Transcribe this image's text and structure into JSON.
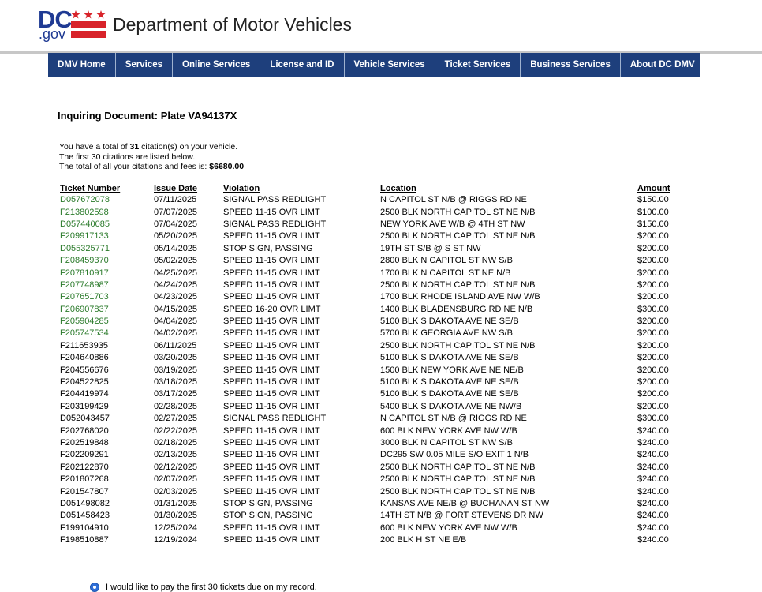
{
  "header": {
    "logo_dc": "DC",
    "logo_gov": ".gov",
    "title": "Department of Motor Vehicles",
    "brand_color": "#1f3a93",
    "flag_color": "#d8232a"
  },
  "nav": {
    "items": [
      {
        "label": "DMV Home"
      },
      {
        "label": "Services"
      },
      {
        "label": "Online Services"
      },
      {
        "label": "License and ID"
      },
      {
        "label": "Vehicle Services"
      },
      {
        "label": "Ticket Services"
      },
      {
        "label": "Business Services"
      },
      {
        "label": "About DC DMV"
      }
    ],
    "color": "#1e3f7c"
  },
  "document": {
    "title": "Inquiring Document: Plate VA94137X",
    "line1_pre": "You have a total of ",
    "line1_count": "31",
    "line1_post": " citation(s) on your vehicle.",
    "line2": "The first 30 citations are listed below.",
    "line3_pre": "The total of all your citations and fees is: ",
    "line3_total": "$6680.00"
  },
  "table": {
    "headers": [
      "Ticket Number",
      "Issue Date",
      "Violation",
      "Location",
      "Amount"
    ],
    "rows": [
      {
        "ticket": "D057672078",
        "date": "07/11/2025",
        "violation": "SIGNAL PASS REDLIGHT",
        "location": "N CAPITOL ST N/B @ RIGGS RD NE",
        "amount": "$150.00",
        "linked": true
      },
      {
        "ticket": "F213802598",
        "date": "07/07/2025",
        "violation": "SPEED 11-15 OVR LIMT",
        "location": "2500 BLK NORTH CAPITOL ST NE N/B",
        "amount": "$100.00",
        "linked": true
      },
      {
        "ticket": "D057440085",
        "date": "07/04/2025",
        "violation": "SIGNAL PASS REDLIGHT",
        "location": "NEW YORK AVE W/B @ 4TH ST NW",
        "amount": "$150.00",
        "linked": true
      },
      {
        "ticket": "F209917133",
        "date": "05/20/2025",
        "violation": "SPEED 11-15 OVR LIMT",
        "location": "2500 BLK NORTH CAPITOL ST NE N/B",
        "amount": "$200.00",
        "linked": true
      },
      {
        "ticket": "D055325771",
        "date": "05/14/2025",
        "violation": "STOP SIGN, PASSING",
        "location": "19TH ST S/B @ S ST NW",
        "amount": "$200.00",
        "linked": true
      },
      {
        "ticket": "F208459370",
        "date": "05/02/2025",
        "violation": "SPEED 11-15 OVR LIMT",
        "location": "2800 BLK N CAPITOL ST NW S/B",
        "amount": "$200.00",
        "linked": true
      },
      {
        "ticket": "F207810917",
        "date": "04/25/2025",
        "violation": "SPEED 11-15 OVR LIMT",
        "location": "1700 BLK N CAPITOL ST NE N/B",
        "amount": "$200.00",
        "linked": true
      },
      {
        "ticket": "F207748987",
        "date": "04/24/2025",
        "violation": "SPEED 11-15 OVR LIMT",
        "location": "2500 BLK NORTH CAPITOL ST NE N/B",
        "amount": "$200.00",
        "linked": true
      },
      {
        "ticket": "F207651703",
        "date": "04/23/2025",
        "violation": "SPEED 11-15 OVR LIMT",
        "location": "1700 BLK RHODE ISLAND AVE NW W/B",
        "amount": "$200.00",
        "linked": true
      },
      {
        "ticket": "F206907837",
        "date": "04/15/2025",
        "violation": "SPEED 16-20 OVR LIMT",
        "location": "1400 BLK BLADENSBURG RD NE N/B",
        "amount": "$300.00",
        "linked": true
      },
      {
        "ticket": "F205904285",
        "date": "04/04/2025",
        "violation": "SPEED 11-15 OVR LIMT",
        "location": "5100 BLK S DAKOTA AVE NE SE/B",
        "amount": "$200.00",
        "linked": true
      },
      {
        "ticket": "F205747534",
        "date": "04/02/2025",
        "violation": "SPEED 11-15 OVR LIMT",
        "location": "5700 BLK GEORGIA AVE NW S/B",
        "amount": "$200.00",
        "linked": true
      },
      {
        "ticket": "F211653935",
        "date": "06/11/2025",
        "violation": "SPEED 11-15 OVR LIMT",
        "location": "2500 BLK NORTH CAPITOL ST NE N/B",
        "amount": "$200.00",
        "linked": false
      },
      {
        "ticket": "F204640886",
        "date": "03/20/2025",
        "violation": "SPEED 11-15 OVR LIMT",
        "location": "5100 BLK S DAKOTA AVE NE SE/B",
        "amount": "$200.00",
        "linked": false
      },
      {
        "ticket": "F204556676",
        "date": "03/19/2025",
        "violation": "SPEED 11-15 OVR LIMT",
        "location": "1500 BLK NEW YORK AVE NE NE/B",
        "amount": "$200.00",
        "linked": false
      },
      {
        "ticket": "F204522825",
        "date": "03/18/2025",
        "violation": "SPEED 11-15 OVR LIMT",
        "location": "5100 BLK S DAKOTA AVE NE SE/B",
        "amount": "$200.00",
        "linked": false
      },
      {
        "ticket": "F204419974",
        "date": "03/17/2025",
        "violation": "SPEED 11-15 OVR LIMT",
        "location": "5100 BLK S DAKOTA AVE NE SE/B",
        "amount": "$200.00",
        "linked": false
      },
      {
        "ticket": "F203199429",
        "date": "02/28/2025",
        "violation": "SPEED 11-15 OVR LIMT",
        "location": "5400 BLK S DAKOTA AVE NE NW/B",
        "amount": "$200.00",
        "linked": false
      },
      {
        "ticket": "D052043457",
        "date": "02/27/2025",
        "violation": "SIGNAL PASS REDLIGHT",
        "location": "N CAPITOL ST N/B @ RIGGS RD NE",
        "amount": "$300.00",
        "linked": false
      },
      {
        "ticket": "F202768020",
        "date": "02/22/2025",
        "violation": "SPEED 11-15 OVR LIMT",
        "location": "600 BLK NEW YORK AVE NW W/B",
        "amount": "$240.00",
        "linked": false
      },
      {
        "ticket": "F202519848",
        "date": "02/18/2025",
        "violation": "SPEED 11-15 OVR LIMT",
        "location": "3000 BLK N CAPITOL ST NW S/B",
        "amount": "$240.00",
        "linked": false
      },
      {
        "ticket": "F202209291",
        "date": "02/13/2025",
        "violation": "SPEED 11-15 OVR LIMT",
        "location": "DC295 SW 0.05 MILE S/O EXIT 1 N/B",
        "amount": "$240.00",
        "linked": false
      },
      {
        "ticket": "F202122870",
        "date": "02/12/2025",
        "violation": "SPEED 11-15 OVR LIMT",
        "location": "2500 BLK NORTH CAPITOL ST NE N/B",
        "amount": "$240.00",
        "linked": false
      },
      {
        "ticket": "F201807268",
        "date": "02/07/2025",
        "violation": "SPEED 11-15 OVR LIMT",
        "location": "2500 BLK NORTH CAPITOL ST NE N/B",
        "amount": "$240.00",
        "linked": false
      },
      {
        "ticket": "F201547807",
        "date": "02/03/2025",
        "violation": "SPEED 11-15 OVR LIMT",
        "location": "2500 BLK NORTH CAPITOL ST NE N/B",
        "amount": "$240.00",
        "linked": false
      },
      {
        "ticket": "D051498082",
        "date": "01/31/2025",
        "violation": "STOP SIGN, PASSING",
        "location": "KANSAS AVE NE/B @ BUCHANAN ST NW",
        "amount": "$240.00",
        "linked": false
      },
      {
        "ticket": "D051458423",
        "date": "01/30/2025",
        "violation": "STOP SIGN, PASSING",
        "location": "14TH ST N/B @ FORT STEVENS DR NW",
        "amount": "$240.00",
        "linked": false
      },
      {
        "ticket": "F199104910",
        "date": "12/25/2024",
        "violation": "SPEED 11-15 OVR LIMT",
        "location": "600 BLK NEW YORK AVE NW W/B",
        "amount": "$240.00",
        "linked": false
      },
      {
        "ticket": "F198510887",
        "date": "12/19/2024",
        "violation": "SPEED 11-15 OVR LIMT",
        "location": "200 BLK H ST NE E/B",
        "amount": "$240.00",
        "linked": false
      }
    ],
    "link_color": "#2a7a2a"
  },
  "payment": {
    "option_label": "I would like to pay the first 30 tickets due on my record."
  }
}
